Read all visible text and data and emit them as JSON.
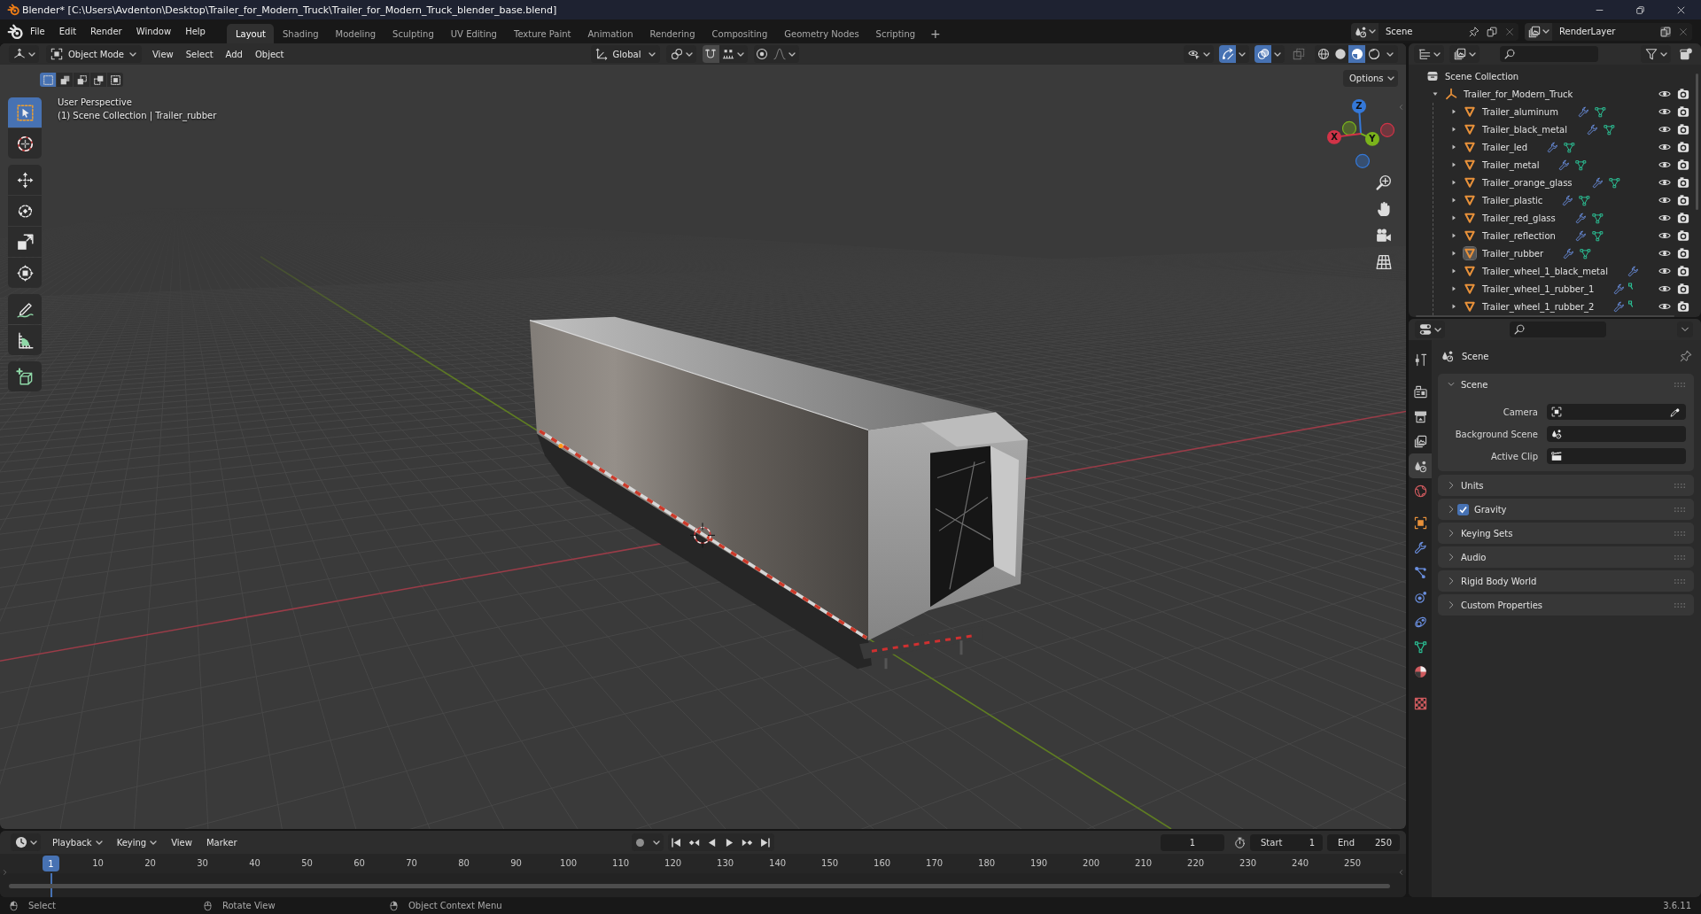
{
  "window": {
    "title": "Blender* [C:\\Users\\Avdenton\\Desktop\\Trailer_for_Modern_Truck\\Trailer_for_Modern_Truck_blender_base.blend]"
  },
  "menu": [
    "File",
    "Edit",
    "Render",
    "Window",
    "Help"
  ],
  "workspaces": [
    {
      "label": "Layout",
      "selected": true
    },
    {
      "label": "Shading",
      "selected": false
    },
    {
      "label": "Modeling",
      "selected": false
    },
    {
      "label": "Sculpting",
      "selected": false
    },
    {
      "label": "UV Editing",
      "selected": false
    },
    {
      "label": "Texture Paint",
      "selected": false
    },
    {
      "label": "Animation",
      "selected": false
    },
    {
      "label": "Rendering",
      "selected": false
    },
    {
      "label": "Compositing",
      "selected": false
    },
    {
      "label": "Geometry Nodes",
      "selected": false
    },
    {
      "label": "Scripting",
      "selected": false
    }
  ],
  "add_workspace": "+",
  "scene": {
    "value": "Scene"
  },
  "view_layer": {
    "value": "RenderLayer"
  },
  "viewport": {
    "mode": "Object Mode",
    "menus": [
      "View",
      "Select",
      "Add",
      "Object"
    ],
    "orientation": "Global",
    "gizmos_on": true,
    "overlays_on": true,
    "xray_on": false,
    "shading": [
      {
        "selected": false
      },
      {
        "selected": false
      },
      {
        "selected": true
      },
      {
        "selected": false
      }
    ],
    "options": "Options",
    "select_modes": [
      {
        "selected": true
      },
      {
        "selected": false
      },
      {
        "selected": false
      },
      {
        "selected": false
      },
      {
        "selected": false
      }
    ],
    "tools": [
      {
        "selected": true
      },
      {
        "selected": false
      },
      {
        "selected": false
      },
      {
        "selected": false
      },
      {
        "selected": false
      },
      {
        "selected": false
      },
      {
        "selected": false
      },
      {
        "selected": false
      },
      {
        "selected": false
      }
    ],
    "info": [
      "User Perspective",
      "(1) Scene Collection | Trailer_rubber"
    ],
    "gizmo_axes": [
      {
        "label": "Z",
        "color": "#3478d8"
      },
      {
        "label": "X",
        "color": "#d23347"
      },
      {
        "label": "Y",
        "color": "#7ab31b"
      }
    ]
  },
  "outliner": {
    "tree": [
      {
        "label": "Scene Collection",
        "kind": "collection",
        "selected": false,
        "children": [
          {
            "label": "Trailer_for_Modern_Truck",
            "kind": "empty",
            "selected": false,
            "expanded": true,
            "visible": true,
            "renderable": true,
            "children": [
              {
                "label": "Trailer_aluminum",
                "kind": "mesh",
                "selected": false,
                "expanded": false,
                "modifiers": true,
                "mesh_data": true,
                "visible": true,
                "renderable": true
              },
              {
                "label": "Trailer_black_metal",
                "kind": "mesh",
                "selected": false,
                "expanded": false,
                "modifiers": true,
                "mesh_data": true,
                "visible": true,
                "renderable": true
              },
              {
                "label": "Trailer_led",
                "kind": "mesh",
                "selected": false,
                "expanded": false,
                "modifiers": true,
                "mesh_data": true,
                "visible": true,
                "renderable": true
              },
              {
                "label": "Trailer_metal",
                "kind": "mesh",
                "selected": false,
                "expanded": false,
                "modifiers": true,
                "mesh_data": true,
                "visible": true,
                "renderable": true
              },
              {
                "label": "Trailer_orange_glass",
                "kind": "mesh",
                "selected": false,
                "expanded": false,
                "modifiers": true,
                "mesh_data": true,
                "visible": true,
                "renderable": true
              },
              {
                "label": "Trailer_plastic",
                "kind": "mesh",
                "selected": false,
                "expanded": false,
                "modifiers": true,
                "mesh_data": true,
                "visible": true,
                "renderable": true
              },
              {
                "label": "Trailer_red_glass",
                "kind": "mesh",
                "selected": false,
                "expanded": false,
                "modifiers": true,
                "mesh_data": true,
                "visible": true,
                "renderable": true
              },
              {
                "label": "Trailer_reflection",
                "kind": "mesh",
                "selected": false,
                "expanded": false,
                "modifiers": true,
                "mesh_data": true,
                "visible": true,
                "renderable": true
              },
              {
                "label": "Trailer_rubber",
                "kind": "mesh",
                "selected": true,
                "expanded": false,
                "modifiers": true,
                "mesh_data": true,
                "visible": true,
                "renderable": true
              },
              {
                "label": "Trailer_wheel_1_black_metal",
                "kind": "mesh",
                "selected": false,
                "expanded": false,
                "modifiers": true,
                "visible": true,
                "renderable": true
              },
              {
                "label": "Trailer_wheel_1_rubber_1",
                "kind": "mesh",
                "selected": false,
                "expanded": false,
                "modifiers": true,
                "mesh_data": true,
                "data_cut": true,
                "visible": true,
                "renderable": true
              },
              {
                "label": "Trailer_wheel_1_rubber_2",
                "kind": "mesh",
                "selected": false,
                "expanded": false,
                "modifiers": true,
                "mesh_data": true,
                "data_cut": true,
                "visible": true,
                "renderable": true
              }
            ]
          }
        ]
      }
    ]
  },
  "properties": {
    "tabs": [
      {
        "selected": false
      },
      {
        "selected": false
      },
      {
        "selected": false
      },
      {
        "selected": false
      },
      {
        "selected": true
      },
      {
        "selected": false
      },
      {
        "selected": false
      },
      {
        "selected": false
      },
      {
        "selected": false
      },
      {
        "selected": false
      },
      {
        "selected": false
      },
      {
        "selected": false
      },
      {
        "selected": false
      },
      {
        "selected": false
      }
    ],
    "context": "Scene",
    "panels": [
      {
        "label": "Scene",
        "kind": "plain",
        "expanded": true,
        "fields": [
          {
            "label": "Camera"
          },
          {
            "label": "Background Scene"
          },
          {
            "label": "Active Clip"
          }
        ]
      },
      {
        "label": "Units",
        "kind": "plain",
        "expanded": false
      },
      {
        "label": "Gravity",
        "kind": "checkbox",
        "expanded": false,
        "checked": true
      },
      {
        "label": "Keying Sets",
        "kind": "plain",
        "expanded": false
      },
      {
        "label": "Audio",
        "kind": "plain",
        "expanded": false
      },
      {
        "label": "Rigid Body World",
        "kind": "plain",
        "expanded": false
      },
      {
        "label": "Custom Properties",
        "kind": "plain",
        "expanded": false
      }
    ]
  },
  "timeline": {
    "menus": [
      {
        "label": "Playback",
        "dropdown": true
      },
      {
        "label": "Keying",
        "dropdown": true
      },
      {
        "label": "View",
        "dropdown": false
      },
      {
        "label": "Marker",
        "dropdown": false
      }
    ],
    "auto_keying": false,
    "current_frame": "1",
    "start": {
      "label": "Start",
      "value": "1"
    },
    "end": {
      "label": "End",
      "value": "250"
    },
    "playhead": "1",
    "ruler": [
      "10",
      "20",
      "30",
      "40",
      "50",
      "60",
      "70",
      "80",
      "90",
      "100",
      "110",
      "120",
      "130",
      "140",
      "150",
      "160",
      "170",
      "180",
      "190",
      "200",
      "210",
      "220",
      "230",
      "240",
      "250"
    ]
  },
  "status": {
    "hints": [
      "Select",
      "Rotate View",
      "Object Context Menu"
    ],
    "version": "3.6.11"
  }
}
